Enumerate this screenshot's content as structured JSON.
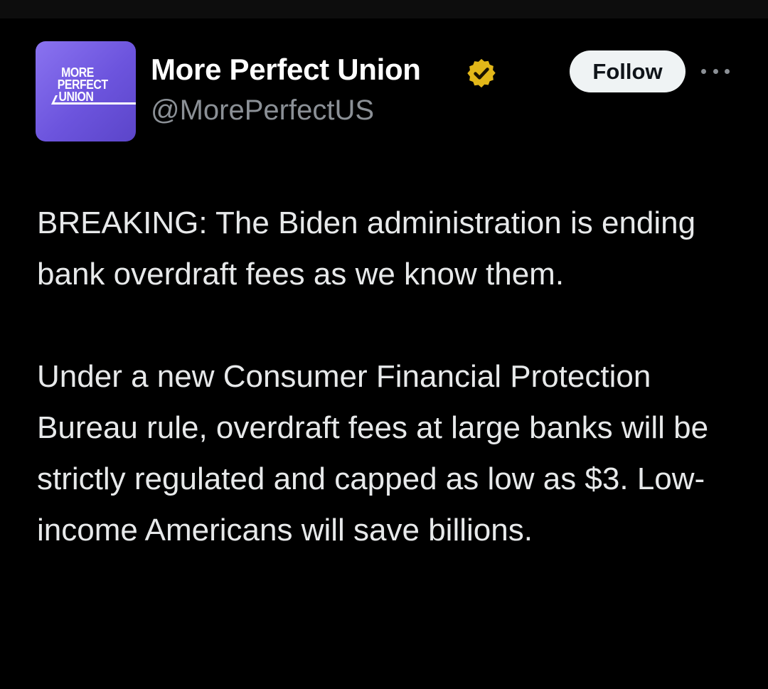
{
  "colors": {
    "background": "#000000",
    "text_primary": "#e7e9ea",
    "text_secondary": "#8b9096",
    "avatar_purple": "#6c54dd",
    "verified_gold": "#e2b719",
    "follow_button_bg": "#eff3f4"
  },
  "account": {
    "display_name": "More Perfect Union",
    "handle": "@MorePerfectUS",
    "verified_icon": "gold-verified-badge-icon",
    "avatar_logo": {
      "line1": "MORE",
      "line2": "PERFECT",
      "line3": "UNION"
    }
  },
  "actions": {
    "follow_label": "Follow",
    "more_icon": "more-horizontal-icon"
  },
  "tweet": {
    "paragraph1": "BREAKING: The Biden administration is ending bank overdraft fees as we know them.",
    "paragraph2": "Under a new Consumer Financial Protection Bureau rule, overdraft fees at large banks will be strictly regulated and capped as low as $3. Low-income Americans will save billions."
  }
}
